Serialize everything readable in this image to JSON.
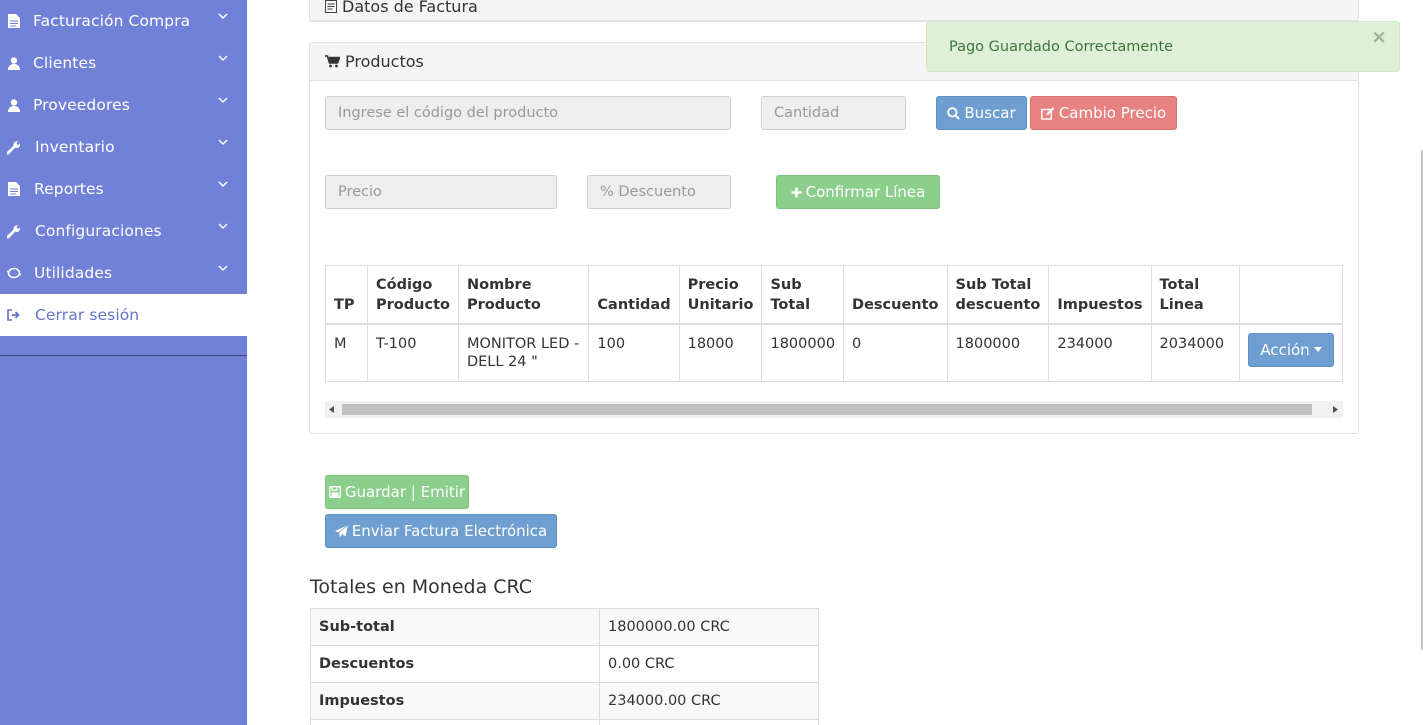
{
  "sidebar": {
    "items": [
      {
        "label": "Facturación Compra",
        "icon": "document-icon"
      },
      {
        "label": "Clientes",
        "icon": "user-icon"
      },
      {
        "label": "Proveedores",
        "icon": "user-icon"
      },
      {
        "label": "Inventario",
        "icon": "wrench-icon"
      },
      {
        "label": "Reportes",
        "icon": "document-icon"
      },
      {
        "label": "Configuraciones",
        "icon": "wrench-icon"
      },
      {
        "label": "Utilidades",
        "icon": "lemon-icon"
      }
    ],
    "logout": "Cerrar sesión"
  },
  "panel_factura": {
    "title": "Datos de Factura"
  },
  "panel_productos": {
    "title": "Productos"
  },
  "form": {
    "codigo_placeholder": "Ingrese el código del producto",
    "cantidad_placeholder": "Cantidad",
    "precio_placeholder": "Precio",
    "descuento_placeholder": "% Descuento",
    "buscar": "Buscar",
    "cambio_precio": "Cambio Precio",
    "confirmar": "Confirmar Línea"
  },
  "table": {
    "headers": [
      "TP",
      "Código Producto",
      "Nombre Producto",
      "Cantidad",
      "Precio Unitario",
      "Sub Total",
      "Descuento",
      "Sub Total descuento",
      "Impuestos",
      "Total Linea",
      ""
    ],
    "rows": [
      [
        "M",
        "T-100",
        "MONITOR LED - DELL 24 \"",
        "100",
        "18000",
        "1800000",
        "0",
        "1800000",
        "234000",
        "2034000"
      ]
    ],
    "action": "Acción"
  },
  "actions": {
    "guardar": "Guardar | Emitir",
    "enviar": "Enviar Factura Electrónica"
  },
  "totals": {
    "title": "Totales en Moneda CRC",
    "rows": [
      {
        "label": "Sub-total",
        "value": "1800000.00 CRC"
      },
      {
        "label": "Descuentos",
        "value": "0.00 CRC"
      },
      {
        "label": "Impuestos",
        "value": "234000.00 CRC"
      }
    ]
  },
  "toast": {
    "message": "Pago Guardado Correctamente",
    "close": "×"
  },
  "colors": {
    "sidebar": "#7181d8",
    "primary": "#6f9fd0",
    "danger": "#e68381",
    "success": "#8ccf8c"
  }
}
